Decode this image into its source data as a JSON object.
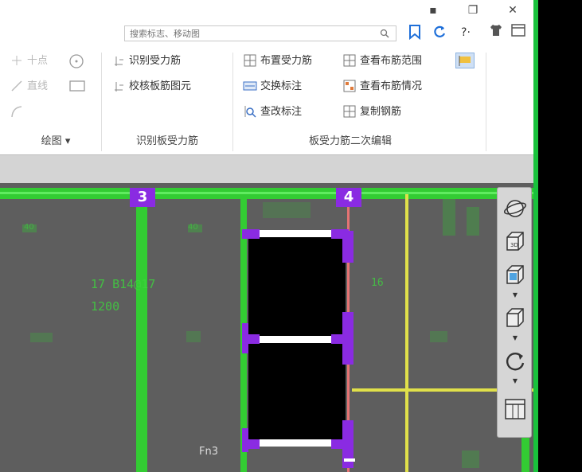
{
  "window": {
    "minimize_symbol": "▪",
    "restore_symbol": "❐",
    "close_symbol": "✕"
  },
  "search": {
    "placeholder": "搜索标志、移动图"
  },
  "toolbar_icons": {
    "bookmark": "bookmark-icon",
    "refresh": "refresh-icon",
    "help_text": "?·",
    "shirt": "shirt-icon",
    "panel": "panel-icon"
  },
  "ribbon": {
    "draw_group": {
      "items": [
        "十点",
        "直线"
      ],
      "label": "绘图",
      "label_arrow": "▾"
    },
    "identify_group": {
      "items": [
        "识别受力筋",
        "校核板筋图元"
      ],
      "label": "识别板受力筋"
    },
    "edit_group": {
      "col1": [
        "布置受力筋",
        "交换标注",
        "查改标注"
      ],
      "col2": [
        "查看布筋范围",
        "查看布筋情况",
        "复制钢筋"
      ],
      "label": "板受力筋二次编辑"
    }
  },
  "canvas": {
    "grid_markers": [
      "3",
      "4"
    ],
    "annotations": {
      "rebar_label_1": "17 B14@17",
      "rebar_label_2": "1200",
      "right_label": "16",
      "left_top": "40",
      "mid_top": "40",
      "bottom_text": "Fn3"
    }
  },
  "colors": {
    "canvas_bg": "#5e5e5e",
    "axis_green": "#33cc33",
    "axis_yellow": "#e0e04a",
    "marker_purple": "#8a2be2",
    "opening_black": "#000000",
    "screen_edge_green": "#19c23c"
  }
}
